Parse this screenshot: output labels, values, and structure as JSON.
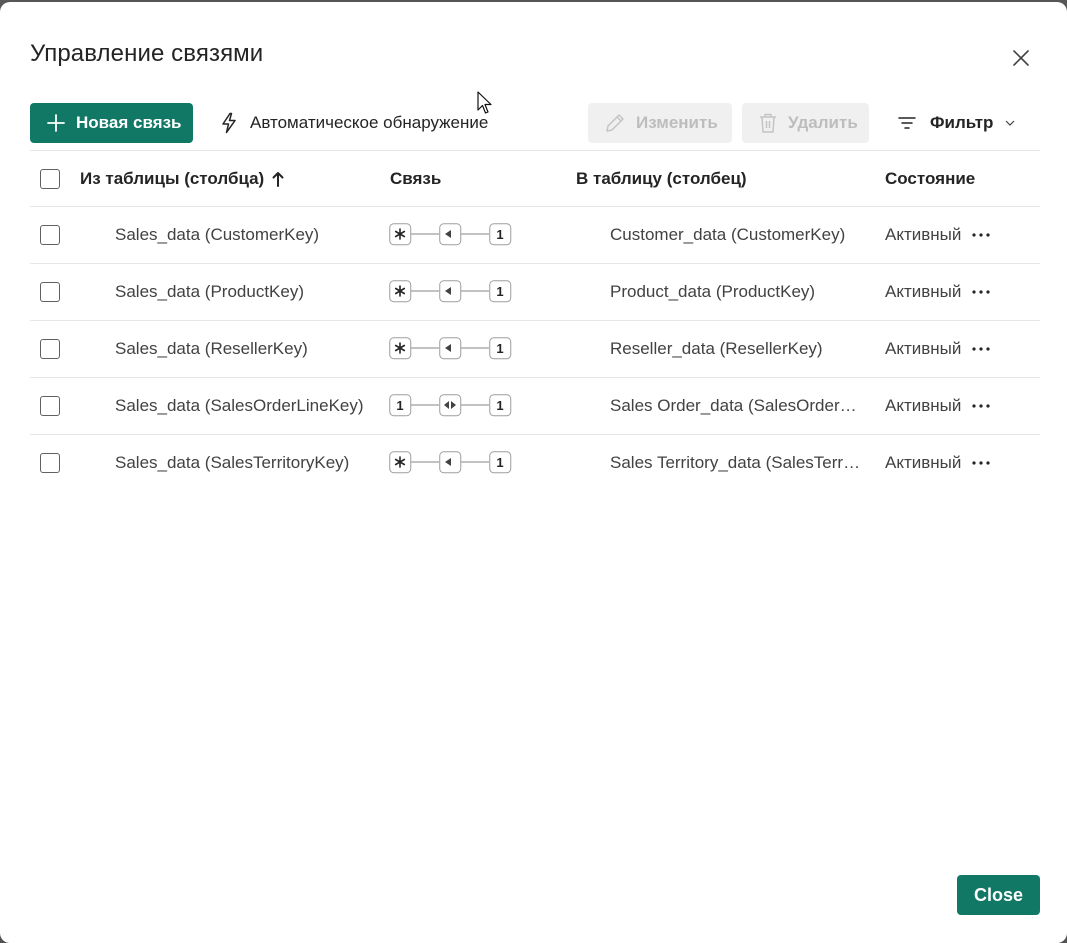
{
  "dialog": {
    "title": "Управление связями",
    "close_label": "Close"
  },
  "toolbar": {
    "new_relationship": "Новая связь",
    "auto_detect": "Автоматическое обнаружение",
    "edit": "Изменить",
    "delete": "Удалить",
    "filter": "Фильтр"
  },
  "table": {
    "headers": {
      "from": "Из таблицы (столбца)",
      "relationship": "Связь",
      "to": "В таблицу (столбец)",
      "state": "Состояние"
    },
    "rows": [
      {
        "from": "Sales_data (CustomerKey)",
        "left_card": "*",
        "direction": "single",
        "right_card": "1",
        "to": "Customer_data (CustomerKey)",
        "state": "Активный"
      },
      {
        "from": "Sales_data (ProductKey)",
        "left_card": "*",
        "direction": "single",
        "right_card": "1",
        "to": "Product_data (ProductKey)",
        "state": "Активный"
      },
      {
        "from": "Sales_data (ResellerKey)",
        "left_card": "*",
        "direction": "single",
        "right_card": "1",
        "to": "Reseller_data (ResellerKey)",
        "state": "Активный"
      },
      {
        "from": "Sales_data (SalesOrderLineKey)",
        "left_card": "1",
        "direction": "both",
        "right_card": "1",
        "to": "Sales Order_data (SalesOrderLi...",
        "state": "Активный"
      },
      {
        "from": "Sales_data (SalesTerritoryKey)",
        "left_card": "*",
        "direction": "single",
        "right_card": "1",
        "to": "Sales Territory_data (SalesTerrit...",
        "state": "Активный"
      }
    ]
  },
  "colors": {
    "primary": "#117865",
    "disabled_bg": "#f0f0f0",
    "disabled_text": "#bdbdbd",
    "divider": "#e6e6e6"
  },
  "icons": {
    "add": "plus-icon",
    "auto_detect": "lightning-icon",
    "edit": "pencil-icon",
    "delete": "trash-icon",
    "filter": "filter-icon",
    "filter_chevron": "chevron-down-icon",
    "sort": "arrow-up-icon",
    "close": "close-icon",
    "more": "more-icon"
  }
}
